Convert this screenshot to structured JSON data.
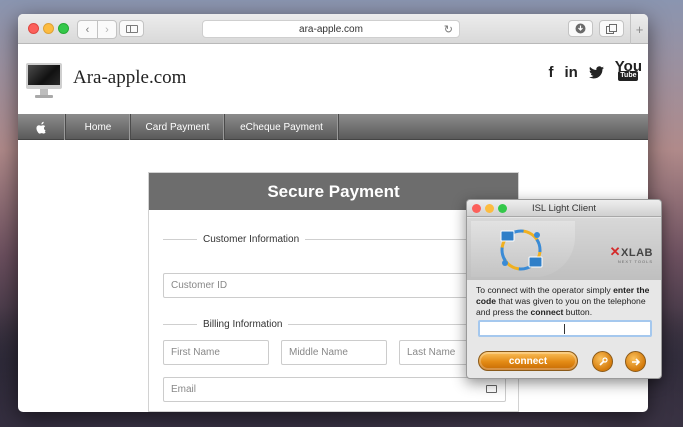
{
  "browser": {
    "url": "ara-apple.com",
    "back_icon": "‹",
    "forward_icon": "›",
    "plus_label": "+"
  },
  "site": {
    "brand": "Ara-apple.com",
    "socials": [
      "f",
      "in",
      "y",
      "You",
      "Tube"
    ]
  },
  "nav": {
    "apple_icon": "",
    "items": [
      "Home",
      "Card Payment",
      "eCheque Payment"
    ]
  },
  "form": {
    "title": "Secure Payment",
    "customer_section": "Customer Information",
    "customer_id_placeholder": "Customer ID",
    "billing_section": "Billing Information",
    "first_name_placeholder": "First Name",
    "middle_name_placeholder": "Middle Name",
    "last_name_placeholder": "Last Name",
    "email_placeholder": "Email"
  },
  "isl": {
    "title": "ISL Light Client",
    "logo": "XLAB",
    "logo_sub": "NEXT TOOLS",
    "instructions_1": "To connect with the operator simply ",
    "instructions_b1": "enter the code",
    "instructions_2": " that was given to you on the telephone and press the ",
    "instructions_b2": "connect",
    "instructions_3": " button.",
    "connect_label": "connect"
  }
}
